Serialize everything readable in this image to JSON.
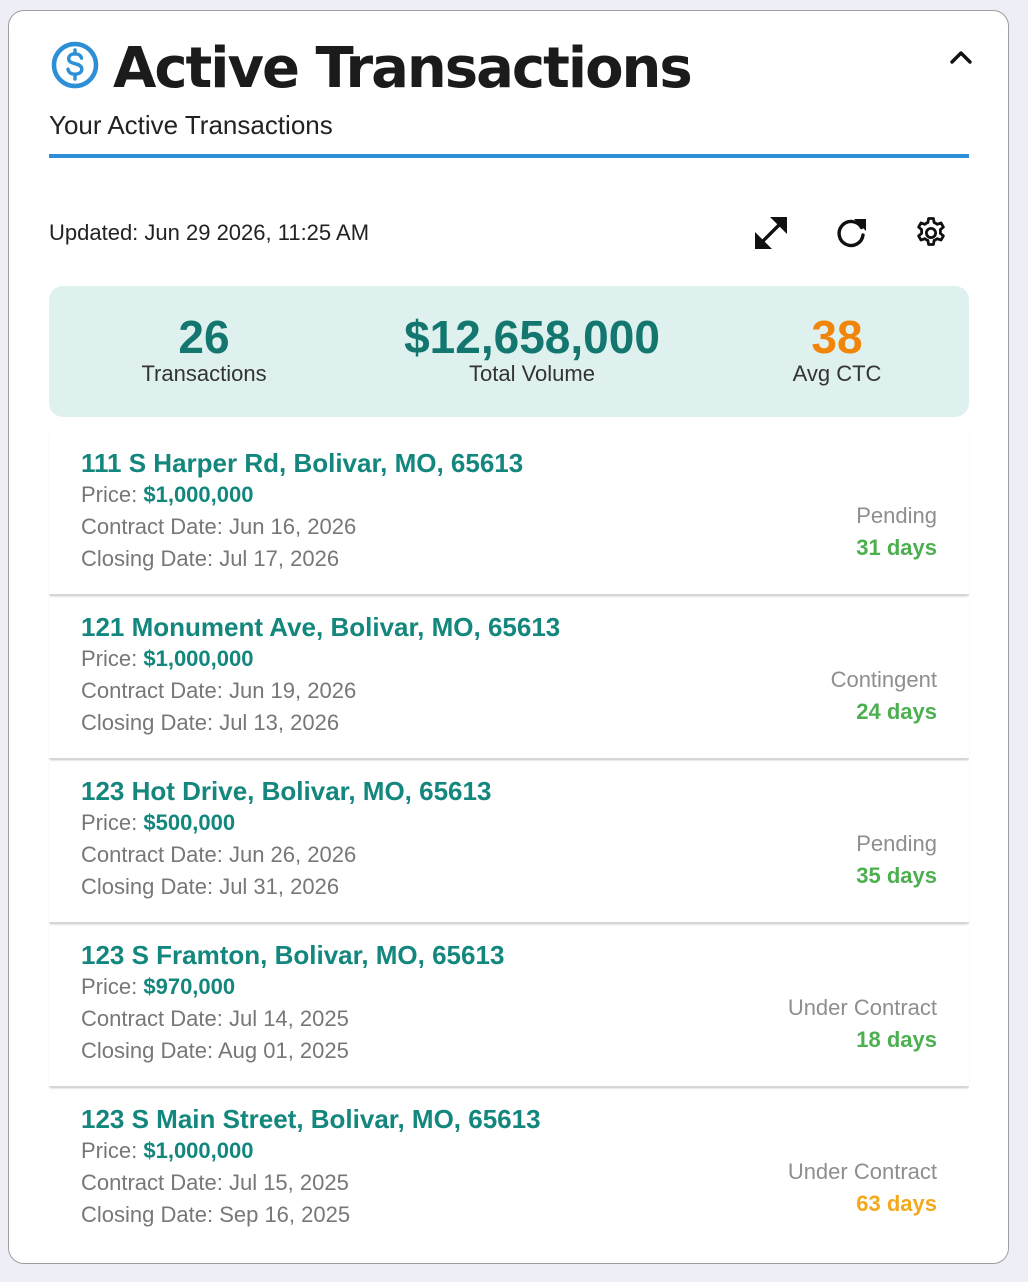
{
  "header": {
    "title": "Active Transactions",
    "subtitle": "Your Active Transactions"
  },
  "updated": "Updated: Jun 29 2026, 11:25 AM",
  "stats": {
    "transactions": {
      "value": "26",
      "label": "Transactions"
    },
    "volume": {
      "value": "$12,658,000",
      "label": "Total Volume"
    },
    "ctc": {
      "value": "38",
      "label": "Avg CTC"
    }
  },
  "labels": {
    "price": "Price: ",
    "contract": "Contract Date: ",
    "closing": "Closing Date: "
  },
  "colors": {
    "accent": "#2d8fd6",
    "teal": "#13877d",
    "green": "#4caf50",
    "orange": "#f0850a",
    "amber": "#f4a91d"
  },
  "transactions": [
    {
      "address": "111 S Harper Rd, Bolivar, MO, 65613",
      "price": "$1,000,000",
      "contract_date": "Jun 16, 2026",
      "closing_date": "Jul 17, 2026",
      "status": "Pending",
      "days": "31 days",
      "days_color": "#4caf50"
    },
    {
      "address": "121 Monument Ave, Bolivar, MO, 65613",
      "price": "$1,000,000",
      "contract_date": "Jun 19, 2026",
      "closing_date": "Jul 13, 2026",
      "status": "Contingent",
      "days": "24 days",
      "days_color": "#4caf50"
    },
    {
      "address": "123 Hot Drive, Bolivar, MO, 65613",
      "price": "$500,000",
      "contract_date": "Jun 26, 2026",
      "closing_date": "Jul 31, 2026",
      "status": "Pending",
      "days": "35 days",
      "days_color": "#4caf50"
    },
    {
      "address": "123 S Framton, Bolivar, MO, 65613",
      "price": "$970,000",
      "contract_date": "Jul 14, 2025",
      "closing_date": "Aug 01, 2025",
      "status": "Under Contract",
      "days": "18 days",
      "days_color": "#4caf50"
    },
    {
      "address": "123 S Main Street, Bolivar, MO, 65613",
      "price": "$1,000,000",
      "contract_date": "Jul 15, 2025",
      "closing_date": "Sep 16, 2025",
      "status": "Under Contract",
      "days": "63 days",
      "days_color": "#f4a91d"
    }
  ]
}
